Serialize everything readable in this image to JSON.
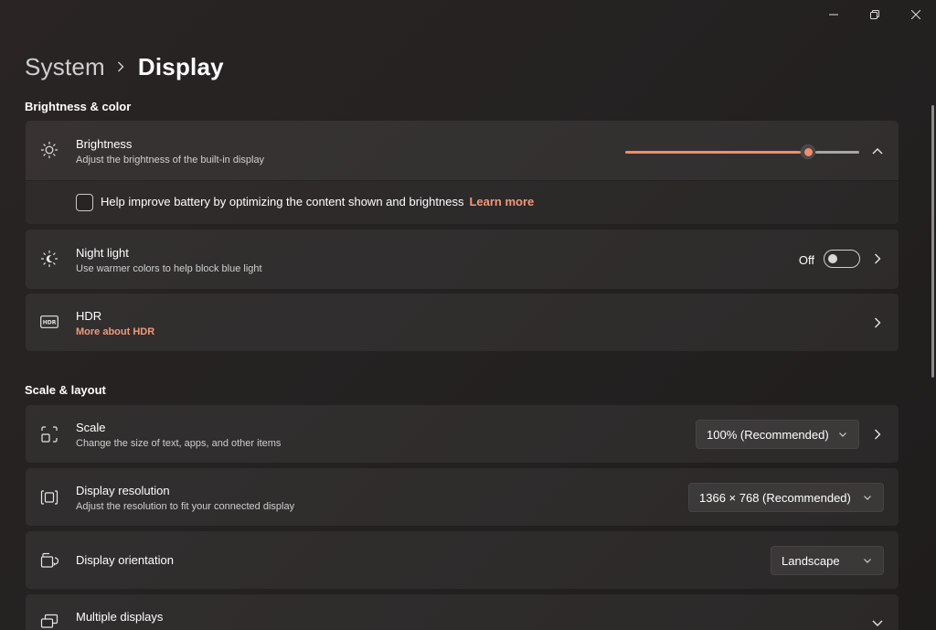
{
  "window": {
    "controls": [
      "minimize-icon",
      "restore-icon",
      "close-icon"
    ]
  },
  "breadcrumb": {
    "parent": "System",
    "current": "Display"
  },
  "sections": {
    "brightness_color": "Brightness & color",
    "scale_layout": "Scale & layout"
  },
  "brightness": {
    "title": "Brightness",
    "subtitle": "Adjust the brightness of the built-in display",
    "level": 0.78,
    "battery_checkbox_label": "Help improve battery by optimizing the content shown and brightness",
    "battery_checkbox_checked": false,
    "learn_more": "Learn more"
  },
  "night_light": {
    "title": "Night light",
    "subtitle": "Use warmer colors to help block blue light",
    "state": "Off"
  },
  "hdr": {
    "title": "HDR",
    "link": "More about HDR"
  },
  "scale": {
    "title": "Scale",
    "subtitle": "Change the size of text, apps, and other items",
    "value": "100% (Recommended)"
  },
  "resolution": {
    "title": "Display resolution",
    "subtitle": "Adjust the resolution to fit your connected display",
    "value": "1366 × 768 (Recommended)"
  },
  "orientation": {
    "title": "Display orientation",
    "value": "Landscape"
  },
  "multiple_displays": {
    "title": "Multiple displays"
  },
  "colors": {
    "accent": "#ef8d6d",
    "link": "#f0997b"
  }
}
